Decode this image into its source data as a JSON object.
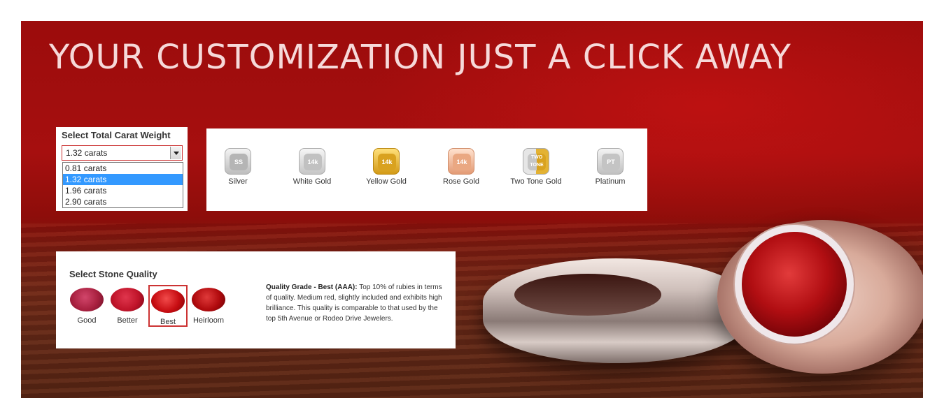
{
  "banner": {
    "title": "YOUR CUSTOMIZATION JUST A CLICK AWAY"
  },
  "carat": {
    "label": "Select Total Carat Weight",
    "selected": "1.32 carats",
    "options": [
      "0.81 carats",
      "1.32 carats",
      "1.96 carats",
      "2.90 carats"
    ]
  },
  "metals": [
    {
      "icon_text": "SS",
      "label": "Silver",
      "color": "#cfcfcf"
    },
    {
      "icon_text": "14k",
      "label": "White Gold",
      "color": "#d9d9d9"
    },
    {
      "icon_text": "14k",
      "label": "Yellow Gold",
      "color": "#e3b233"
    },
    {
      "icon_text": "14k",
      "label": "Rose Gold",
      "color": "#f0b08c"
    },
    {
      "icon_text": "TWO TONE",
      "label": "Two Tone Gold",
      "color": "#e0c060"
    },
    {
      "icon_text": "PT",
      "label": "Platinum",
      "color": "#d5d5d5"
    }
  ],
  "quality": {
    "title": "Select Stone Quality",
    "grades": [
      {
        "label": "Good",
        "color": "#a8203f"
      },
      {
        "label": "Better",
        "color": "#c0142a"
      },
      {
        "label": "Best",
        "color": "#c70d12"
      },
      {
        "label": "Heirloom",
        "color": "#b00a0d"
      }
    ],
    "selected": "Best",
    "desc_heading": "Quality Grade - Best (AAA):",
    "desc_text": "Top 10% of rubies in terms of quality.  Medium red, slightly included and exhibits high brilliance.  This quality is comparable to that used by the top 5th Avenue or Rodeo Drive Jewelers."
  }
}
